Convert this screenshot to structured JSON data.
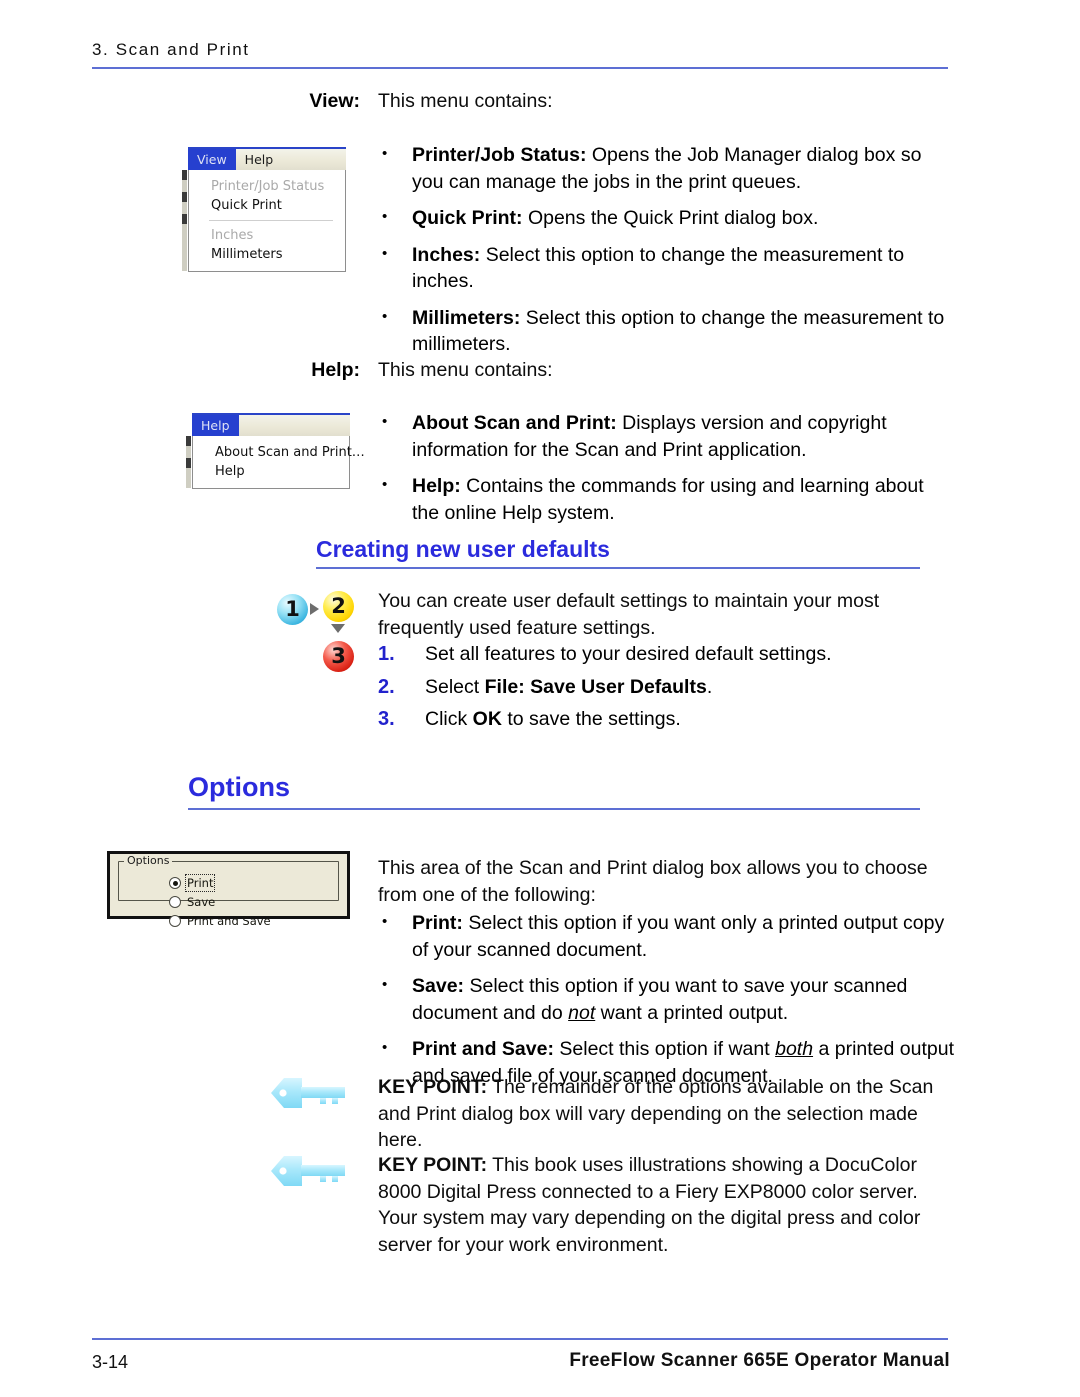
{
  "page": {
    "running_head": "3. Scan and Print",
    "footer_page_number": "3-14",
    "footer_title": "FreeFlow Scanner 665E Operator Manual",
    "accent_color": "#2b2bdd",
    "rule_color": "#5d6fd4"
  },
  "view_section": {
    "label": "View:",
    "intro": "This menu contains:",
    "bullets": [
      {
        "term": "Printer/Job Status:",
        "text": " Opens the Job Manager dialog box so you can manage the jobs in the print queues."
      },
      {
        "term": "Quick Print:",
        "text": " Opens the Quick Print dialog box."
      },
      {
        "term": "Inches:",
        "text": " Select this option to change the measurement to inches."
      },
      {
        "term": "Millimeters:",
        "text": " Select this option to change the measurement to millimeters."
      }
    ]
  },
  "view_menu_screenshot": {
    "menubar": [
      {
        "label": "View",
        "selected": true
      },
      {
        "label": "Help",
        "selected": false
      }
    ],
    "items": [
      {
        "label": "Printer/Job Status",
        "disabled": true
      },
      {
        "label": "Quick Print",
        "disabled": false
      },
      {
        "separator": true
      },
      {
        "label": "Inches",
        "disabled": true
      },
      {
        "label": "Millimeters",
        "disabled": false
      }
    ]
  },
  "help_section": {
    "label": "Help:",
    "intro": "This menu contains:",
    "bullets": [
      {
        "term": "About Scan and Print:",
        "text": " Displays version and copyright information for the Scan and Print application."
      },
      {
        "term": "Help:",
        "text": " Contains the commands for using and learning about the online Help system."
      }
    ]
  },
  "help_menu_screenshot": {
    "menubar": [
      {
        "label": "Help",
        "selected": true
      }
    ],
    "items": [
      {
        "label": "About Scan and Print…",
        "disabled": false
      },
      {
        "label": "Help",
        "disabled": false
      }
    ]
  },
  "creating_defaults": {
    "heading": "Creating new user defaults",
    "intro": "You can create user default settings to maintain your most frequently used feature settings.",
    "steps": [
      {
        "number": "1.",
        "pre": "Set all features to your desired default settings.",
        "bold": "",
        "post": ""
      },
      {
        "number": "2.",
        "pre": "Select ",
        "bold": "File: Save User Defaults",
        "post": "."
      },
      {
        "number": "3.",
        "pre": "Click ",
        "bold": "OK",
        "post": " to save the settings."
      }
    ],
    "graphic": {
      "step1": "1",
      "step2": "2",
      "step3": "3",
      "color1": "#3bb5e0",
      "color2": "#ffd400",
      "color3": "#d81f12"
    }
  },
  "options_section": {
    "heading": "Options",
    "intro": "This area of the Scan and Print dialog box allows you to choose from one of the following:",
    "bullets": [
      {
        "term": "Print:",
        "pre": " Select this option if you want only a printed output copy of your scanned document.",
        "emph": "",
        "post": ""
      },
      {
        "term": "Save:",
        "pre": " Select this option if you want to save your scanned document and do ",
        "emph": "not",
        "post": " want a printed output."
      },
      {
        "term": "Print and Save:",
        "pre": " Select this option if want ",
        "emph": "both",
        "post": " a printed output and saved file of your scanned document."
      }
    ]
  },
  "options_screenshot": {
    "legend": "Options",
    "radios": [
      {
        "label": "Print",
        "selected": true,
        "focused": true
      },
      {
        "label": "Save",
        "selected": false,
        "focused": false
      },
      {
        "label": "Print and Save",
        "selected": false,
        "focused": false
      }
    ]
  },
  "key_points": [
    {
      "term": "KEY POINT:",
      "text": " The remainder of the options available on the Scan and Print dialog box will vary depending on the selection made here."
    },
    {
      "term": "KEY POINT:",
      "text": " This book uses illustrations showing a DocuColor 8000 Digital Press connected to a Fiery EXP8000 color server.  Your system may vary depending on the digital press and color server for your work environment."
    }
  ]
}
